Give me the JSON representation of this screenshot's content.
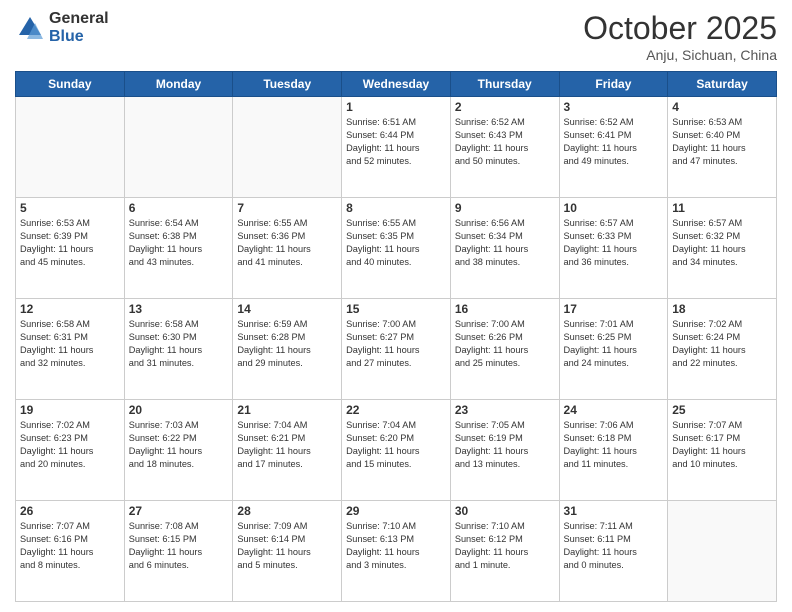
{
  "logo": {
    "general": "General",
    "blue": "Blue"
  },
  "header": {
    "month": "October 2025",
    "location": "Anju, Sichuan, China"
  },
  "days": [
    "Sunday",
    "Monday",
    "Tuesday",
    "Wednesday",
    "Thursday",
    "Friday",
    "Saturday"
  ],
  "weeks": [
    [
      {
        "num": "",
        "text": ""
      },
      {
        "num": "",
        "text": ""
      },
      {
        "num": "",
        "text": ""
      },
      {
        "num": "1",
        "text": "Sunrise: 6:51 AM\nSunset: 6:44 PM\nDaylight: 11 hours\nand 52 minutes."
      },
      {
        "num": "2",
        "text": "Sunrise: 6:52 AM\nSunset: 6:43 PM\nDaylight: 11 hours\nand 50 minutes."
      },
      {
        "num": "3",
        "text": "Sunrise: 6:52 AM\nSunset: 6:41 PM\nDaylight: 11 hours\nand 49 minutes."
      },
      {
        "num": "4",
        "text": "Sunrise: 6:53 AM\nSunset: 6:40 PM\nDaylight: 11 hours\nand 47 minutes."
      }
    ],
    [
      {
        "num": "5",
        "text": "Sunrise: 6:53 AM\nSunset: 6:39 PM\nDaylight: 11 hours\nand 45 minutes."
      },
      {
        "num": "6",
        "text": "Sunrise: 6:54 AM\nSunset: 6:38 PM\nDaylight: 11 hours\nand 43 minutes."
      },
      {
        "num": "7",
        "text": "Sunrise: 6:55 AM\nSunset: 6:36 PM\nDaylight: 11 hours\nand 41 minutes."
      },
      {
        "num": "8",
        "text": "Sunrise: 6:55 AM\nSunset: 6:35 PM\nDaylight: 11 hours\nand 40 minutes."
      },
      {
        "num": "9",
        "text": "Sunrise: 6:56 AM\nSunset: 6:34 PM\nDaylight: 11 hours\nand 38 minutes."
      },
      {
        "num": "10",
        "text": "Sunrise: 6:57 AM\nSunset: 6:33 PM\nDaylight: 11 hours\nand 36 minutes."
      },
      {
        "num": "11",
        "text": "Sunrise: 6:57 AM\nSunset: 6:32 PM\nDaylight: 11 hours\nand 34 minutes."
      }
    ],
    [
      {
        "num": "12",
        "text": "Sunrise: 6:58 AM\nSunset: 6:31 PM\nDaylight: 11 hours\nand 32 minutes."
      },
      {
        "num": "13",
        "text": "Sunrise: 6:58 AM\nSunset: 6:30 PM\nDaylight: 11 hours\nand 31 minutes."
      },
      {
        "num": "14",
        "text": "Sunrise: 6:59 AM\nSunset: 6:28 PM\nDaylight: 11 hours\nand 29 minutes."
      },
      {
        "num": "15",
        "text": "Sunrise: 7:00 AM\nSunset: 6:27 PM\nDaylight: 11 hours\nand 27 minutes."
      },
      {
        "num": "16",
        "text": "Sunrise: 7:00 AM\nSunset: 6:26 PM\nDaylight: 11 hours\nand 25 minutes."
      },
      {
        "num": "17",
        "text": "Sunrise: 7:01 AM\nSunset: 6:25 PM\nDaylight: 11 hours\nand 24 minutes."
      },
      {
        "num": "18",
        "text": "Sunrise: 7:02 AM\nSunset: 6:24 PM\nDaylight: 11 hours\nand 22 minutes."
      }
    ],
    [
      {
        "num": "19",
        "text": "Sunrise: 7:02 AM\nSunset: 6:23 PM\nDaylight: 11 hours\nand 20 minutes."
      },
      {
        "num": "20",
        "text": "Sunrise: 7:03 AM\nSunset: 6:22 PM\nDaylight: 11 hours\nand 18 minutes."
      },
      {
        "num": "21",
        "text": "Sunrise: 7:04 AM\nSunset: 6:21 PM\nDaylight: 11 hours\nand 17 minutes."
      },
      {
        "num": "22",
        "text": "Sunrise: 7:04 AM\nSunset: 6:20 PM\nDaylight: 11 hours\nand 15 minutes."
      },
      {
        "num": "23",
        "text": "Sunrise: 7:05 AM\nSunset: 6:19 PM\nDaylight: 11 hours\nand 13 minutes."
      },
      {
        "num": "24",
        "text": "Sunrise: 7:06 AM\nSunset: 6:18 PM\nDaylight: 11 hours\nand 11 minutes."
      },
      {
        "num": "25",
        "text": "Sunrise: 7:07 AM\nSunset: 6:17 PM\nDaylight: 11 hours\nand 10 minutes."
      }
    ],
    [
      {
        "num": "26",
        "text": "Sunrise: 7:07 AM\nSunset: 6:16 PM\nDaylight: 11 hours\nand 8 minutes."
      },
      {
        "num": "27",
        "text": "Sunrise: 7:08 AM\nSunset: 6:15 PM\nDaylight: 11 hours\nand 6 minutes."
      },
      {
        "num": "28",
        "text": "Sunrise: 7:09 AM\nSunset: 6:14 PM\nDaylight: 11 hours\nand 5 minutes."
      },
      {
        "num": "29",
        "text": "Sunrise: 7:10 AM\nSunset: 6:13 PM\nDaylight: 11 hours\nand 3 minutes."
      },
      {
        "num": "30",
        "text": "Sunrise: 7:10 AM\nSunset: 6:12 PM\nDaylight: 11 hours\nand 1 minute."
      },
      {
        "num": "31",
        "text": "Sunrise: 7:11 AM\nSunset: 6:11 PM\nDaylight: 11 hours\nand 0 minutes."
      },
      {
        "num": "",
        "text": ""
      }
    ]
  ]
}
